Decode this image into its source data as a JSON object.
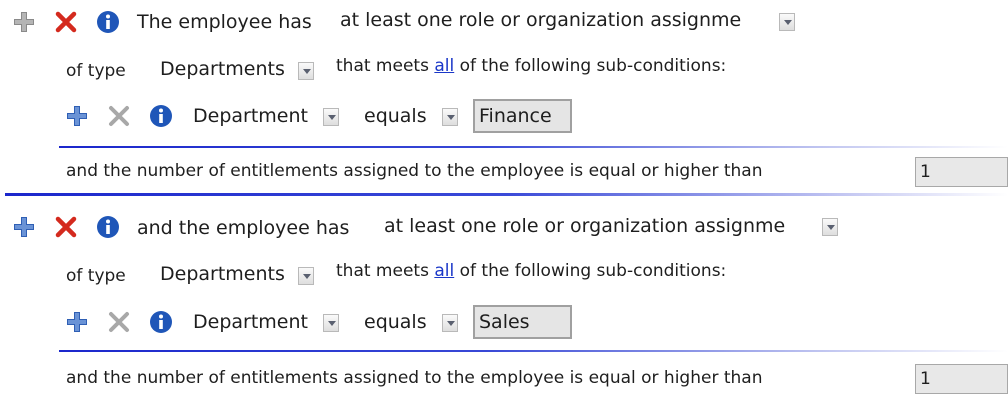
{
  "conditions": [
    {
      "prefix": "The employee has",
      "assignment_value": "at least one role or organization assignme",
      "of_type_label": "of type",
      "type_value": "Departments",
      "meets_prefix": "that meets",
      "meets_link": "all",
      "meets_suffix": "of the following sub-conditions:",
      "sub": {
        "attribute": "Department",
        "operator": "equals",
        "value": "Finance"
      },
      "entitlements_text": "and the number of entitlements assigned to the employee is equal or higher than",
      "entitlements_value": "1",
      "add_active": false
    },
    {
      "prefix": "and the employee has",
      "assignment_value": "at least one role or organization assignme",
      "of_type_label": "of type",
      "type_value": "Departments",
      "meets_prefix": "that meets",
      "meets_link": "all",
      "meets_suffix": "of the following sub-conditions:",
      "sub": {
        "attribute": "Department",
        "operator": "equals",
        "value": "Sales"
      },
      "entitlements_text": "and the number of entitlements assigned to the employee is equal or higher than",
      "entitlements_value": "1",
      "add_active": true
    }
  ],
  "colors": {
    "add_active": "#2f5fb4",
    "add_inactive": "#8a8a8a",
    "remove_active": "#d42a1e",
    "remove_inactive": "#a8a8a8",
    "info": "#1f56b8",
    "link": "#1a37c8",
    "divider": "#1b27cc"
  },
  "icons": [
    "plus-icon",
    "close-icon",
    "info-icon",
    "dropdown-arrow-icon"
  ]
}
